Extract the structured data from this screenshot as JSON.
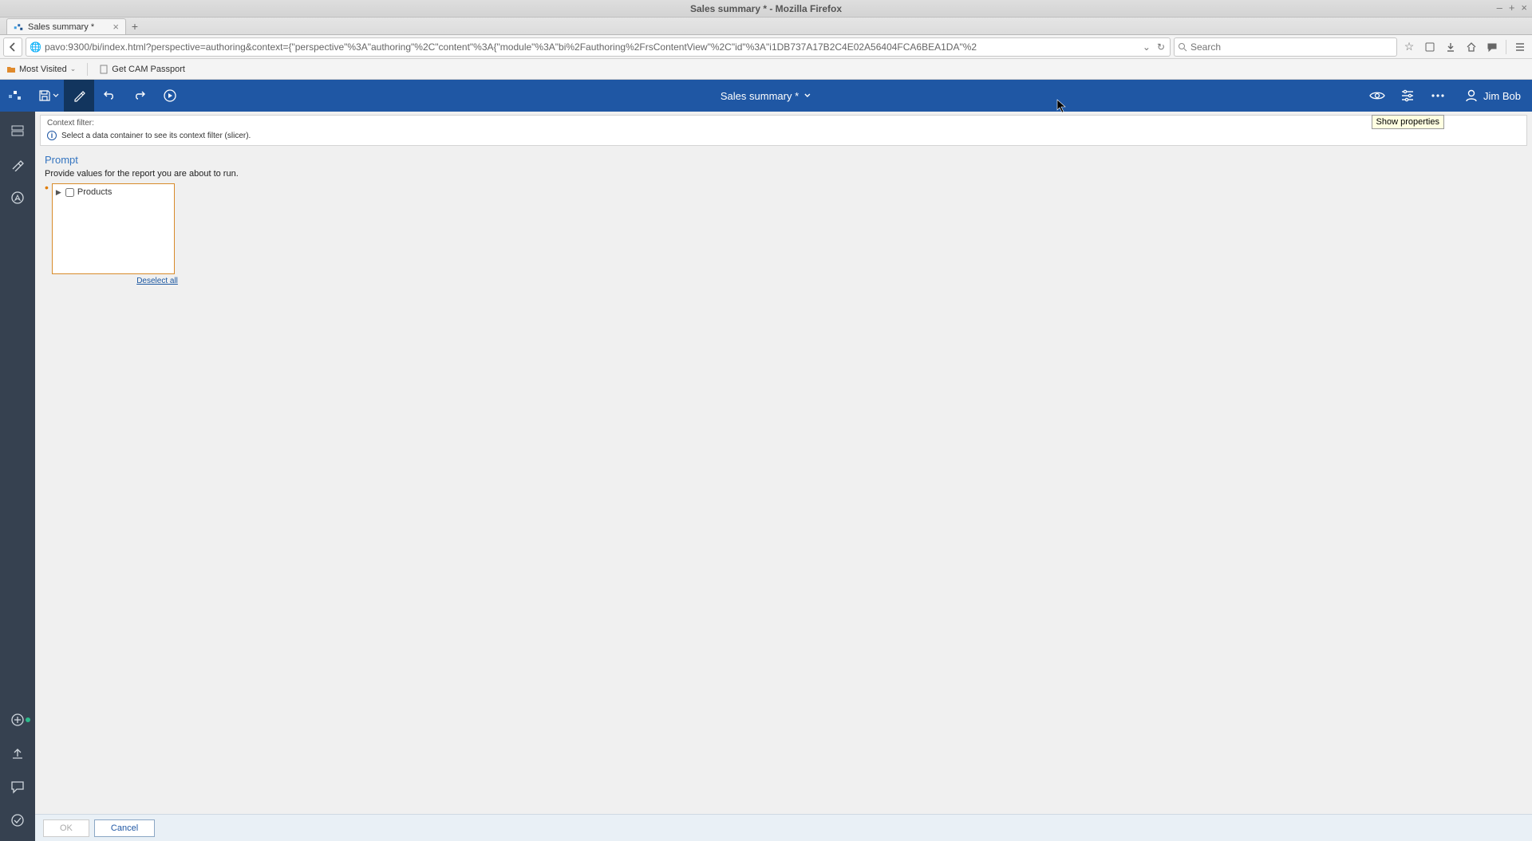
{
  "os": {
    "window_title": "Sales summary * - Mozilla Firefox",
    "min": "–",
    "max": "+",
    "close": "×"
  },
  "browser": {
    "tab_label": "Sales summary *",
    "url": "pavo:9300/bi/index.html?perspective=authoring&context={\"perspective\"%3A\"authoring\"%2C\"content\"%3A{\"module\"%3A\"bi%2Fauthoring%2FrsContentView\"%2C\"id\"%3A\"i1DB737A17B2C4E02A56404FCA6BEA1DA\"%2",
    "search_placeholder": "Search",
    "bookmarks": {
      "most_visited": "Most Visited",
      "get_cam": "Get CAM Passport"
    }
  },
  "appbar": {
    "title": "Sales summary *",
    "user": "Jim Bob",
    "tooltip": "Show properties"
  },
  "context_filter": {
    "label": "Context filter:",
    "info": "Select a data container to see its context filter (slicer)."
  },
  "prompt": {
    "heading": "Prompt",
    "description": "Provide values for the report you are about to run.",
    "tree_root": "Products",
    "deselect": "Deselect all"
  },
  "footer": {
    "ok": "OK",
    "cancel": "Cancel"
  }
}
